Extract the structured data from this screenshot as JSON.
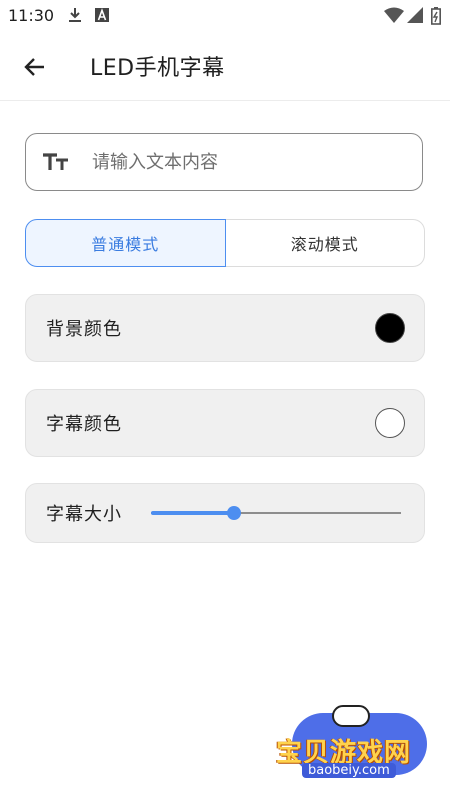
{
  "status_bar": {
    "time": "11:30",
    "icons": [
      "download-icon",
      "font-a-icon",
      "wifi-icon",
      "signal-icon",
      "battery-icon"
    ]
  },
  "app_bar": {
    "title": "LED手机字幕",
    "back_icon": "arrow-left-icon"
  },
  "text_input": {
    "icon": "text-size-icon",
    "value": "",
    "placeholder": "请输入文本内容"
  },
  "mode_toggle": {
    "options": [
      {
        "label": "普通模式",
        "selected": true
      },
      {
        "label": "滚动模式",
        "selected": false
      }
    ]
  },
  "settings": {
    "background_color": {
      "label": "背景颜色",
      "value": "#000000"
    },
    "text_color": {
      "label": "字幕颜色",
      "value": "#ffffff"
    },
    "text_size": {
      "label": "字幕大小",
      "value_fraction": 0.33
    }
  },
  "colors": {
    "accent": "#4d8ef0",
    "selected_bg": "#eef5ff",
    "card_bg": "#f0f0f0"
  },
  "watermark": {
    "text": "宝贝游戏网",
    "url": "baobeiy.com"
  }
}
